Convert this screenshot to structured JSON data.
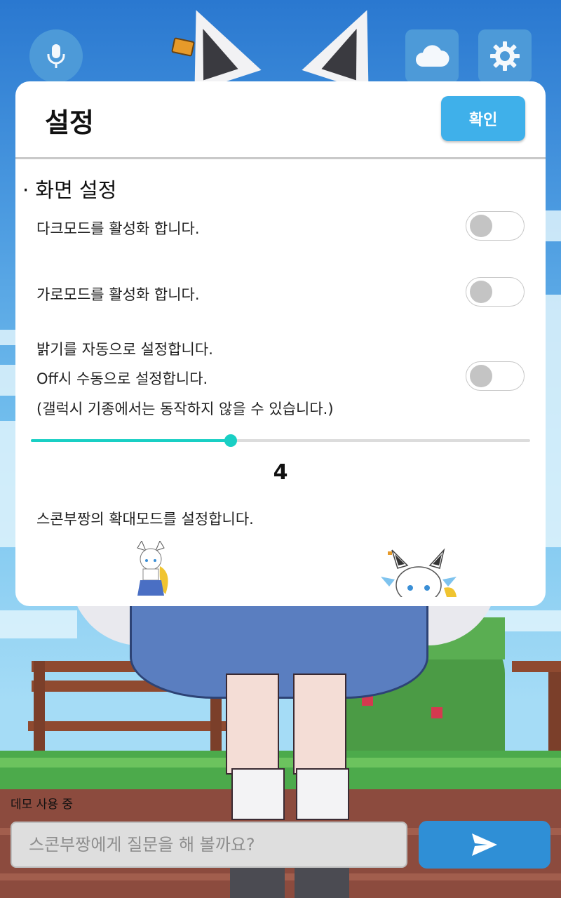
{
  "top_bar": {
    "mic_icon": "microphone-icon",
    "cloud_icon": "cloud-icon",
    "settings_icon": "gear-icon"
  },
  "modal": {
    "title": "설정",
    "confirm_label": "확인",
    "section_title": "· 화면 설정",
    "settings": [
      {
        "label": "다크모드를 활성화 합니다.",
        "enabled": false
      },
      {
        "label": "가로모드를 활성화 합니다.",
        "enabled": false
      },
      {
        "label_lines": [
          "밝기를 자동으로 설정합니다.",
          "Off시 수동으로 설정합니다.",
          "(갤럭시 기종에서는 동작하지 않을 수 있습니다.)"
        ],
        "enabled": false
      }
    ],
    "brightness": {
      "value": "4",
      "fraction": 0.4
    },
    "zoom_label": "스콘부짱의 확대모드를 설정합니다.",
    "zoom_options": [
      "small-character-thumbnail",
      "zoomed-character-thumbnail"
    ]
  },
  "bottom": {
    "demo_text": "데모 사용 중",
    "input_placeholder": "스콘부짱에게 질문을 해 볼까요?",
    "input_value": "",
    "send_icon": "send-icon"
  },
  "colors": {
    "accent": "#3fb0ea",
    "slider": "#19cfc4",
    "button_bg": "#4f9cd9",
    "send_bg": "#2f8fd6"
  }
}
